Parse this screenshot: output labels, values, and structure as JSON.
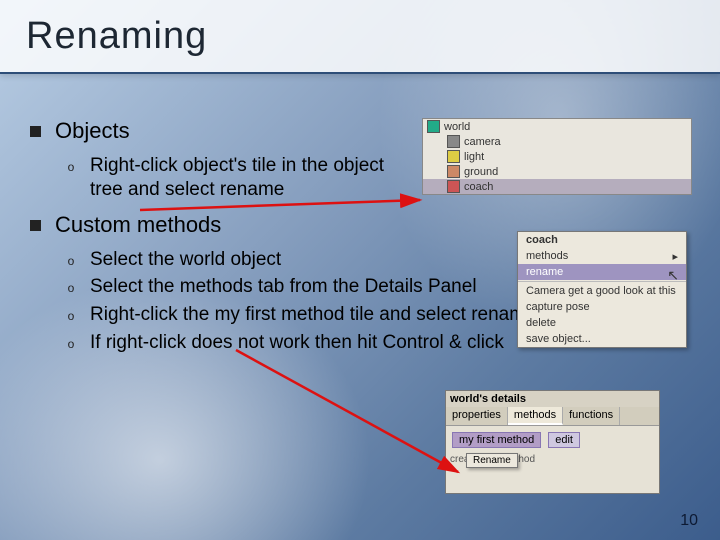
{
  "title": "Renaming",
  "page_number": "10",
  "sections": {
    "objects": {
      "heading": "Objects",
      "items": [
        "Right-click object's tile in the object tree and select rename"
      ]
    },
    "custom_methods": {
      "heading": "Custom methods",
      "items": [
        "Select the world object",
        "Select the methods tab from the Details Panel",
        "Right-click the my first method tile and select rename",
        "If right-click does not work then hit Control & click"
      ]
    }
  },
  "object_tree": {
    "items": [
      {
        "icon": "globe",
        "label": "world"
      },
      {
        "icon": "camera",
        "label": "camera"
      },
      {
        "icon": "light",
        "label": "light"
      },
      {
        "icon": "ground",
        "label": "ground"
      },
      {
        "icon": "person",
        "label": "coach",
        "selected": true
      }
    ]
  },
  "context_menu": {
    "items": [
      {
        "label": "coach",
        "header": true
      },
      {
        "label": "methods",
        "arrow": true
      },
      {
        "label": "rename",
        "highlighted": true
      },
      {
        "sep": true
      },
      {
        "label": "Camera get a good look at this"
      },
      {
        "label": "capture pose"
      },
      {
        "label": "delete"
      },
      {
        "label": "save object..."
      }
    ]
  },
  "details_panel": {
    "title": "world's details",
    "tabs": [
      "properties",
      "methods",
      "functions"
    ],
    "active_tab": "methods",
    "tiles": [
      "my first method",
      "edit"
    ],
    "mini_menu_label": "Rename",
    "create_label": "create new method"
  }
}
